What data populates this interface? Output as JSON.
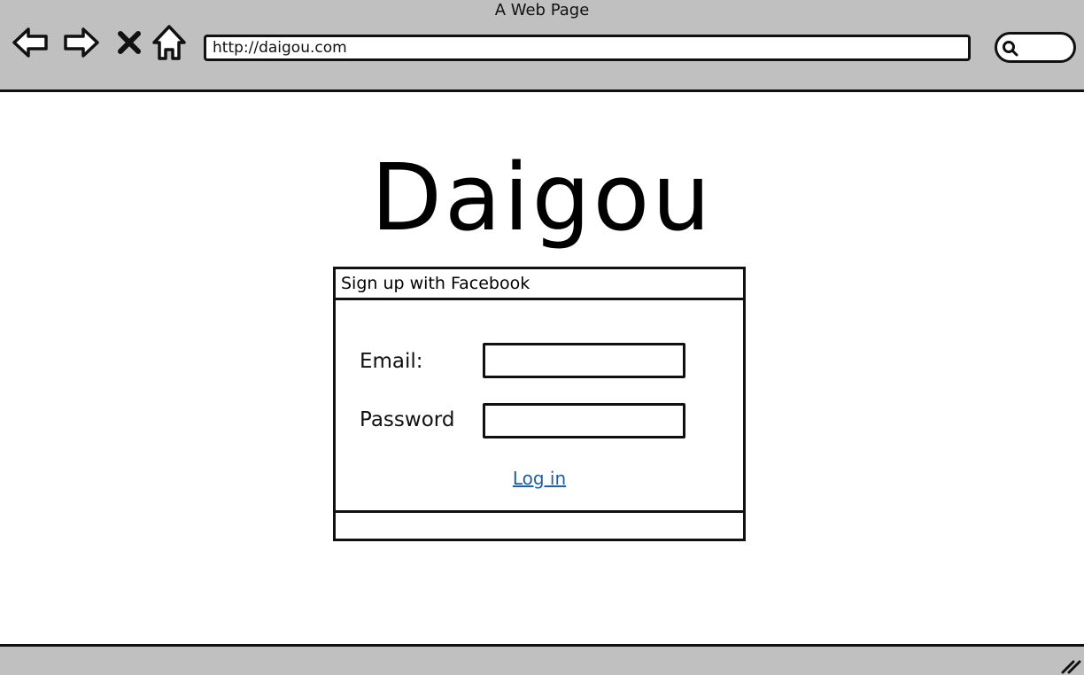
{
  "window": {
    "title": "A Web Page"
  },
  "toolbar": {
    "back_icon": "back-arrow-icon",
    "forward_icon": "forward-arrow-icon",
    "stop_icon": "close-icon",
    "home_icon": "home-icon",
    "url": "http://daigou.com",
    "search_icon": "search-icon"
  },
  "page": {
    "logo": "Daigou",
    "panel": {
      "header": "Sign up with Facebook",
      "email_label": "Email:",
      "password_label": "Password",
      "login_link": "Log in"
    }
  },
  "statusbar": {
    "grip_icon": "resize-grip-icon"
  }
}
